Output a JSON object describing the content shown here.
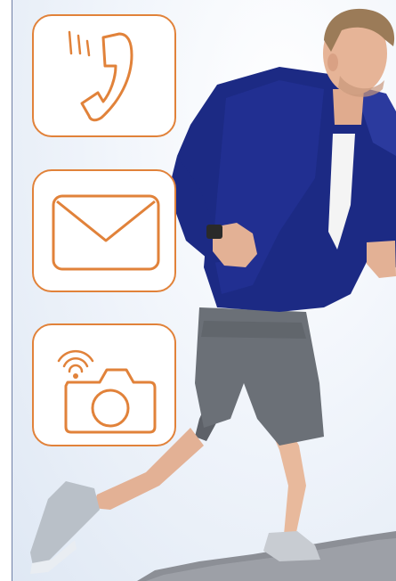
{
  "colors": {
    "icon_accent": "#e1823a",
    "frame": "#6f7fa6",
    "hoodie": "#1c2a84",
    "shorts": "#6b7077",
    "sky": "#eef3fa"
  },
  "icons": [
    "phone-call-icon",
    "envelope-icon",
    "wireless-camera-icon"
  ]
}
